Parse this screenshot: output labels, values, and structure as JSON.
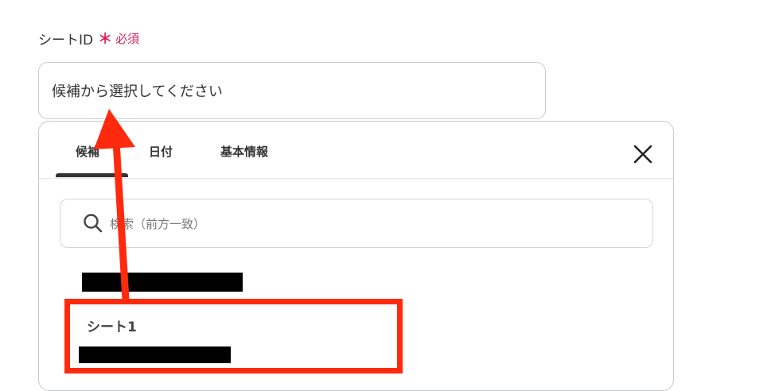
{
  "field": {
    "label": "シートID",
    "required_mark": "＊",
    "required_text": "必須",
    "placeholder": "候補から選択してください"
  },
  "dropdown": {
    "tabs": [
      {
        "label": "候補",
        "active": true
      },
      {
        "label": "日付",
        "active": false
      },
      {
        "label": "基本情報",
        "active": false
      }
    ],
    "close_icon": "close-icon",
    "search": {
      "placeholder": "検索（前方一致）",
      "icon": "search-icon"
    },
    "options": [
      {
        "label": ""
      },
      {
        "label": "シート1"
      }
    ]
  },
  "annotation": {
    "highlight_color": "#ff2a0e",
    "arrow_color": "#ff2a0e"
  },
  "colors": {
    "required": "#e0245e",
    "text": "#333333",
    "border": "#c9cdd3"
  }
}
